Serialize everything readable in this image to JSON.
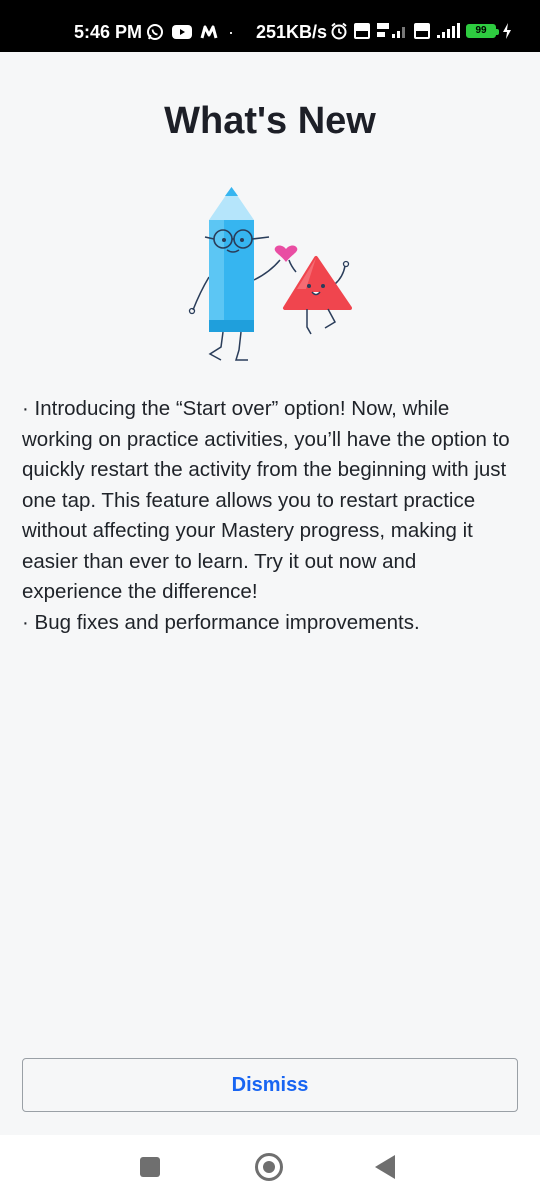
{
  "status_bar": {
    "time": "5:46 PM",
    "network_speed": "251KB/s",
    "battery_level": "99",
    "icons_left": [
      "whatsapp-icon",
      "youtube-icon",
      "app-m-icon"
    ],
    "icons_right": [
      "alarm-icon",
      "volte-icon",
      "signal-5g-icon",
      "volte-icon",
      "signal-icon",
      "battery-icon",
      "charging-icon"
    ]
  },
  "dialog": {
    "title": "What's New",
    "paragraphs": [
      "· Introducing the “Start over” option! Now, while working on practice activities, you’ll have the option to quickly restart the activity from the beginning with just one tap. This feature allows you to restart practice without affecting your Mastery progress, making it easier than ever to learn. Try it out now and experience the difference!",
      "· Bug fixes and performance improvements."
    ],
    "dismiss_label": "Dismiss"
  },
  "colors": {
    "accent": "#1865f2",
    "background": "#f6f7f8",
    "title_text": "#1d1f27",
    "pencil": "#36b5f0",
    "triangle": "#f0454e",
    "heart": "#e94ea3"
  },
  "nav_bar": {
    "buttons": [
      "recent-apps",
      "home",
      "back"
    ]
  }
}
